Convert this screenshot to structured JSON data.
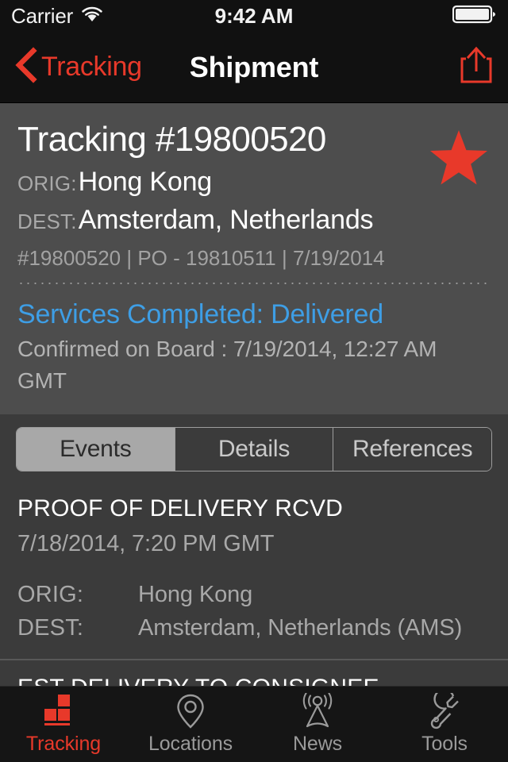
{
  "status_bar": {
    "carrier": "Carrier",
    "wifi_icon": "wifi-icon",
    "time": "9:42 AM",
    "battery_icon": "battery-full-icon"
  },
  "nav_bar": {
    "back_icon": "chevron-left-icon",
    "back_label": "Tracking",
    "title": "Shipment",
    "share_icon": "share-icon"
  },
  "shipment_header": {
    "title": "Tracking #19800520",
    "favorite_icon": "star-icon",
    "orig_label": "ORIG:",
    "orig_value": "Hong Kong",
    "dest_label": "DEST:",
    "dest_value": "Amsterdam, Netherlands",
    "meta": "#19800520 | PO - 19810511 | 7/19/2014",
    "status_main": "Services Completed: Delivered",
    "status_sub": "Confirmed on Board : 7/19/2014, 12:27 AM GMT"
  },
  "segmented_control": {
    "selected": "Events",
    "options": [
      {
        "label": "Events",
        "active": true
      },
      {
        "label": "Details",
        "active": false
      },
      {
        "label": "References",
        "active": false
      }
    ]
  },
  "events": [
    {
      "title": "PROOF OF DELIVERY RCVD",
      "date": "7/18/2014, 7:20 PM GMT",
      "orig_label": "ORIG:",
      "orig_value": "Hong Kong",
      "dest_label": "DEST:",
      "dest_value": "Amsterdam, Netherlands (AMS)"
    },
    {
      "title": "EST DELIVERY TO CONSIGNEE",
      "date": "",
      "orig_label": "",
      "orig_value": "",
      "dest_label": "",
      "dest_value": ""
    }
  ],
  "tab_bar": {
    "items": [
      {
        "label": "Tracking",
        "icon": "boxes-icon",
        "active": true
      },
      {
        "label": "Locations",
        "icon": "map-pin-icon",
        "active": false
      },
      {
        "label": "News",
        "icon": "broadcast-tower-icon",
        "active": false
      },
      {
        "label": "Tools",
        "icon": "wrench-icon",
        "active": false
      }
    ]
  },
  "colors": {
    "accent_red": "#e8392a",
    "status_blue": "#3e9ee5",
    "header_bg": "#4d4d4d",
    "content_bg": "#3b3b3b",
    "chrome_bg": "#111111"
  }
}
